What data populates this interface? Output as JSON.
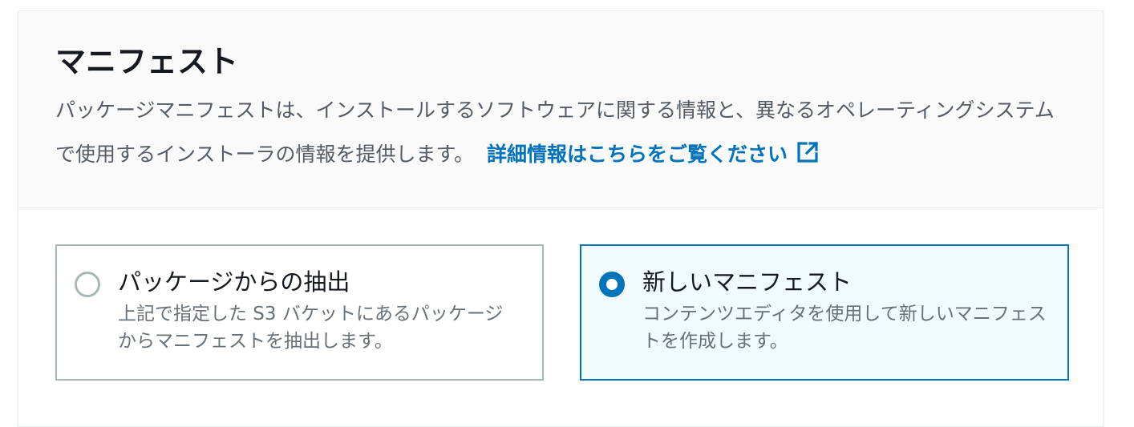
{
  "section": {
    "title": "マニフェスト",
    "description": "パッケージマニフェストは、インストールするソフトウェアに関する情報と、異なるオペレーティングシステムで使用するインストーラの情報を提供します。",
    "info_link_label": "詳細情報はこちらをご覧ください",
    "info_link_icon": "external-link-icon"
  },
  "options": [
    {
      "label": "パッケージからの抽出",
      "description": "上記で指定した S3 バケットにあるパッケージからマニフェストを抽出します。",
      "selected": false
    },
    {
      "label": "新しいマニフェスト",
      "description": "コンテンツエディタを使用して新しいマニフェストを作成します。",
      "selected": true
    }
  ],
  "colors": {
    "accent": "#0073bb",
    "selected_background": "#f1faff",
    "border": "#aab7b8",
    "text_primary": "#16191f",
    "text_secondary": "#687078"
  }
}
